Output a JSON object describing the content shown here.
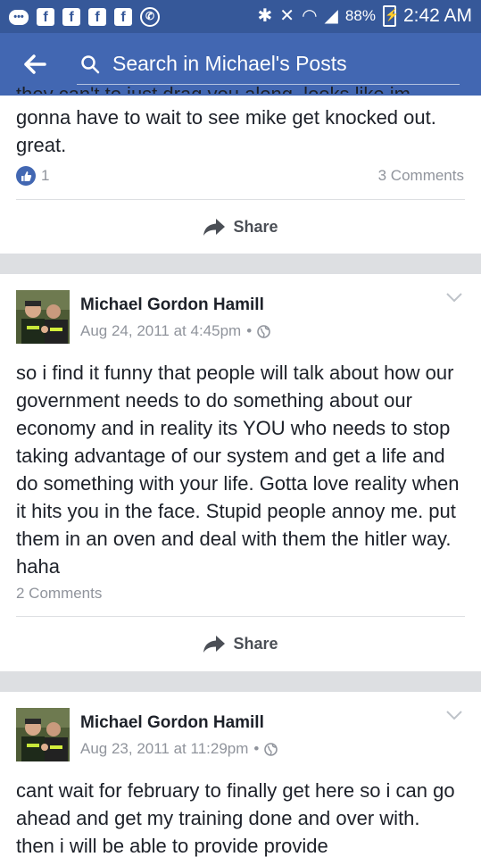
{
  "status_bar": {
    "left_icons": [
      "facebook-icon",
      "facebook-icon",
      "facebook-icon",
      "facebook-icon",
      "whatsapp-icon"
    ],
    "battery": "88%",
    "time": "2:42 AM"
  },
  "header": {
    "search_placeholder": "Search in Michael's Posts"
  },
  "posts": [
    {
      "text_partial": "they can't to just drag you along. looks like im",
      "text": "gonna have to wait to see mike get knocked out. great.",
      "likes": "1",
      "comments": "3 Comments",
      "share": "Share"
    },
    {
      "author": "Michael Gordon Hamill",
      "date": "Aug 24, 2011 at 4:45pm",
      "separator": "•",
      "text": "so i find it funny that people will talk about how our government needs to do something about our economy and in reality its YOU who needs to stop taking advantage of our system and get a life and do something with your life. Gotta love reality when it hits you in the face. Stupid people annoy me. put them in an oven and deal with them the hitler way. haha",
      "comments": "2 Comments",
      "share": "Share"
    },
    {
      "author": "Michael Gordon Hamill",
      "date": "Aug 23, 2011 at 11:29pm",
      "separator": "•",
      "text": "cant wait for  february to finally get here so i can go ahead and get my training done and over with. then i will be able to provide provide"
    }
  ],
  "colors": {
    "status_bar": "#365899",
    "header": "#4267b2",
    "background": "#dddfe2",
    "text": "#1d2129",
    "secondary_text": "#90949c"
  }
}
